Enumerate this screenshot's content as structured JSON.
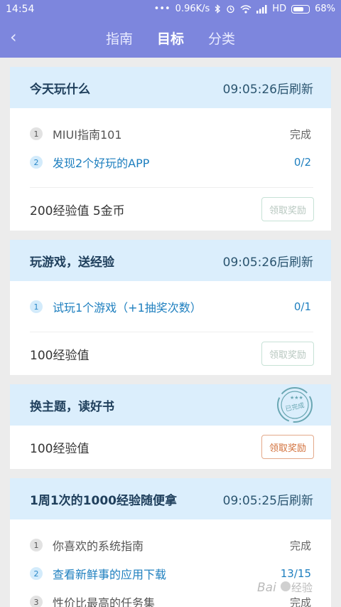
{
  "status": {
    "time": "14:54",
    "network_speed": "0.96K/s",
    "network": "HD",
    "battery": "68%"
  },
  "nav": {
    "tabs": [
      "指南",
      "目标",
      "分类"
    ],
    "active_tab": "目标"
  },
  "cards": [
    {
      "title": "今天玩什么",
      "refresh": "09:05:26后刷新",
      "tasks": [
        {
          "num": "1",
          "label": "MIUI指南101",
          "status": "完成"
        },
        {
          "num": "2",
          "label": "发现2个好玩的APP",
          "status": "0/2"
        }
      ],
      "reward": "200经验值 5金币",
      "button": "领取奖励"
    },
    {
      "title": "玩游戏，送经验",
      "refresh": "09:05:26后刷新",
      "tasks": [
        {
          "num": "1",
          "label": "试玩1个游戏（+1抽奖次数）",
          "status": "0/1"
        }
      ],
      "reward": "100经验值",
      "button": "领取奖励"
    },
    {
      "title": "换主题，读好书",
      "stamp": "已完成",
      "reward": "100经验值",
      "button": "领取奖励"
    },
    {
      "title": "1周1次的1000经验随便拿",
      "refresh": "09:05:25后刷新",
      "tasks": [
        {
          "num": "1",
          "label": "你喜欢的系统指南",
          "status": "完成"
        },
        {
          "num": "2",
          "label": "查看新鲜事的应用下载",
          "status": "13/15"
        },
        {
          "num": "3",
          "label": "性价比最高的任务集",
          "status": "完成"
        }
      ]
    }
  ],
  "watermark": "Bai du 经验"
}
